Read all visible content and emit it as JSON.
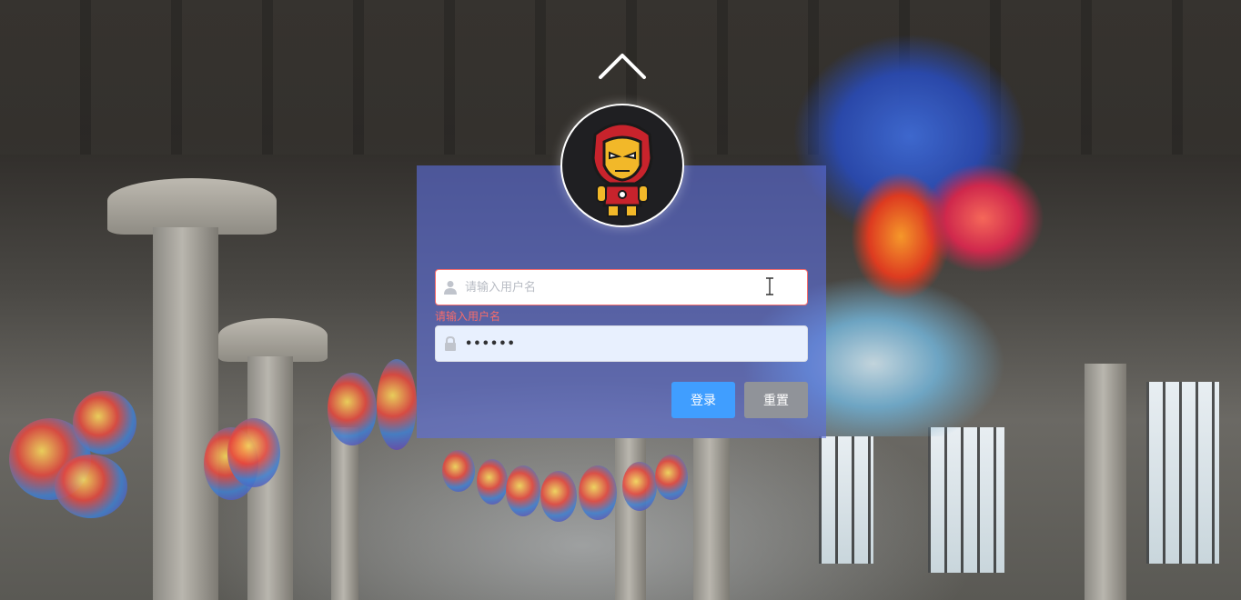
{
  "login": {
    "username_placeholder": "请输入用户名",
    "username_error": "请输入用户名",
    "password_value": "••••••",
    "login_label": "登录",
    "reset_label": "重置"
  },
  "icons": {
    "top": "chevron-up-icon",
    "avatar": "iron-man-avatar",
    "username": "user-icon",
    "password": "lock-icon",
    "cursor": "text-cursor-icon"
  },
  "colors": {
    "panel": "#5c6edc",
    "primary_button": "#409eff",
    "secondary_button": "#909399",
    "error": "#f56c6c"
  }
}
